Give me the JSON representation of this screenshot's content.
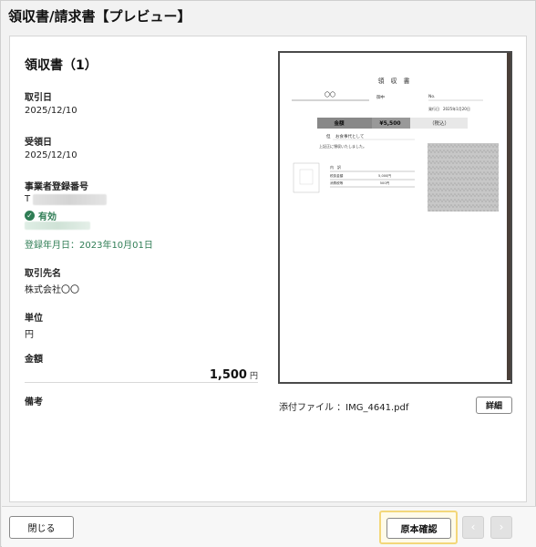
{
  "window": {
    "title": "領収書/請求書【プレビュー】"
  },
  "document": {
    "heading": "領収書（1）",
    "fields": {
      "transaction_date_label": "取引日",
      "transaction_date": "2025/12/10",
      "received_date_label": "受領日",
      "received_date": "2025/12/10",
      "registration_label": "事業者登録番号",
      "registration_prefix": "T",
      "valid_status": "有効",
      "registration_date": "登録年月日：2023年10月01日",
      "vendor_label": "取引先名",
      "vendor": "株式会社〇〇",
      "unit_label": "単位",
      "unit": "円",
      "amount_label": "金額",
      "amount": "1,500",
      "amount_unit": "円",
      "memo_label": "備考"
    }
  },
  "preview": {
    "receipt_title": "領　収　書",
    "recipient": "〇〇",
    "honorific": "御中",
    "no_label": "No.",
    "issue_date": "発行日　2025年1月20日",
    "amount_label": "金額",
    "amount": "¥5,500",
    "tax_note": "（税込）",
    "purpose_prefix": "但",
    "purpose": "お食事代として",
    "received_note": "上記正に領収いたしました。",
    "breakdown_label": "内　訳",
    "tax_excl_label": "税抜金額",
    "tax_excl_value": "5,000円",
    "tax_label": "消費税等",
    "tax_value": "500円"
  },
  "attachment": {
    "label": "添付ファイル ：IMG_4641.pdf",
    "detail_label": "詳細"
  },
  "footer": {
    "close_label": "閉じる",
    "confirm_label": "原本確認",
    "prev_glyph": "‹",
    "next_glyph": "›"
  },
  "colors": {
    "accent_green": "#2f7d55",
    "highlight": "#f3d77a"
  },
  "icons": {
    "valid": "check-circle-icon",
    "prev": "chevron-left-icon",
    "next": "chevron-right-icon"
  }
}
